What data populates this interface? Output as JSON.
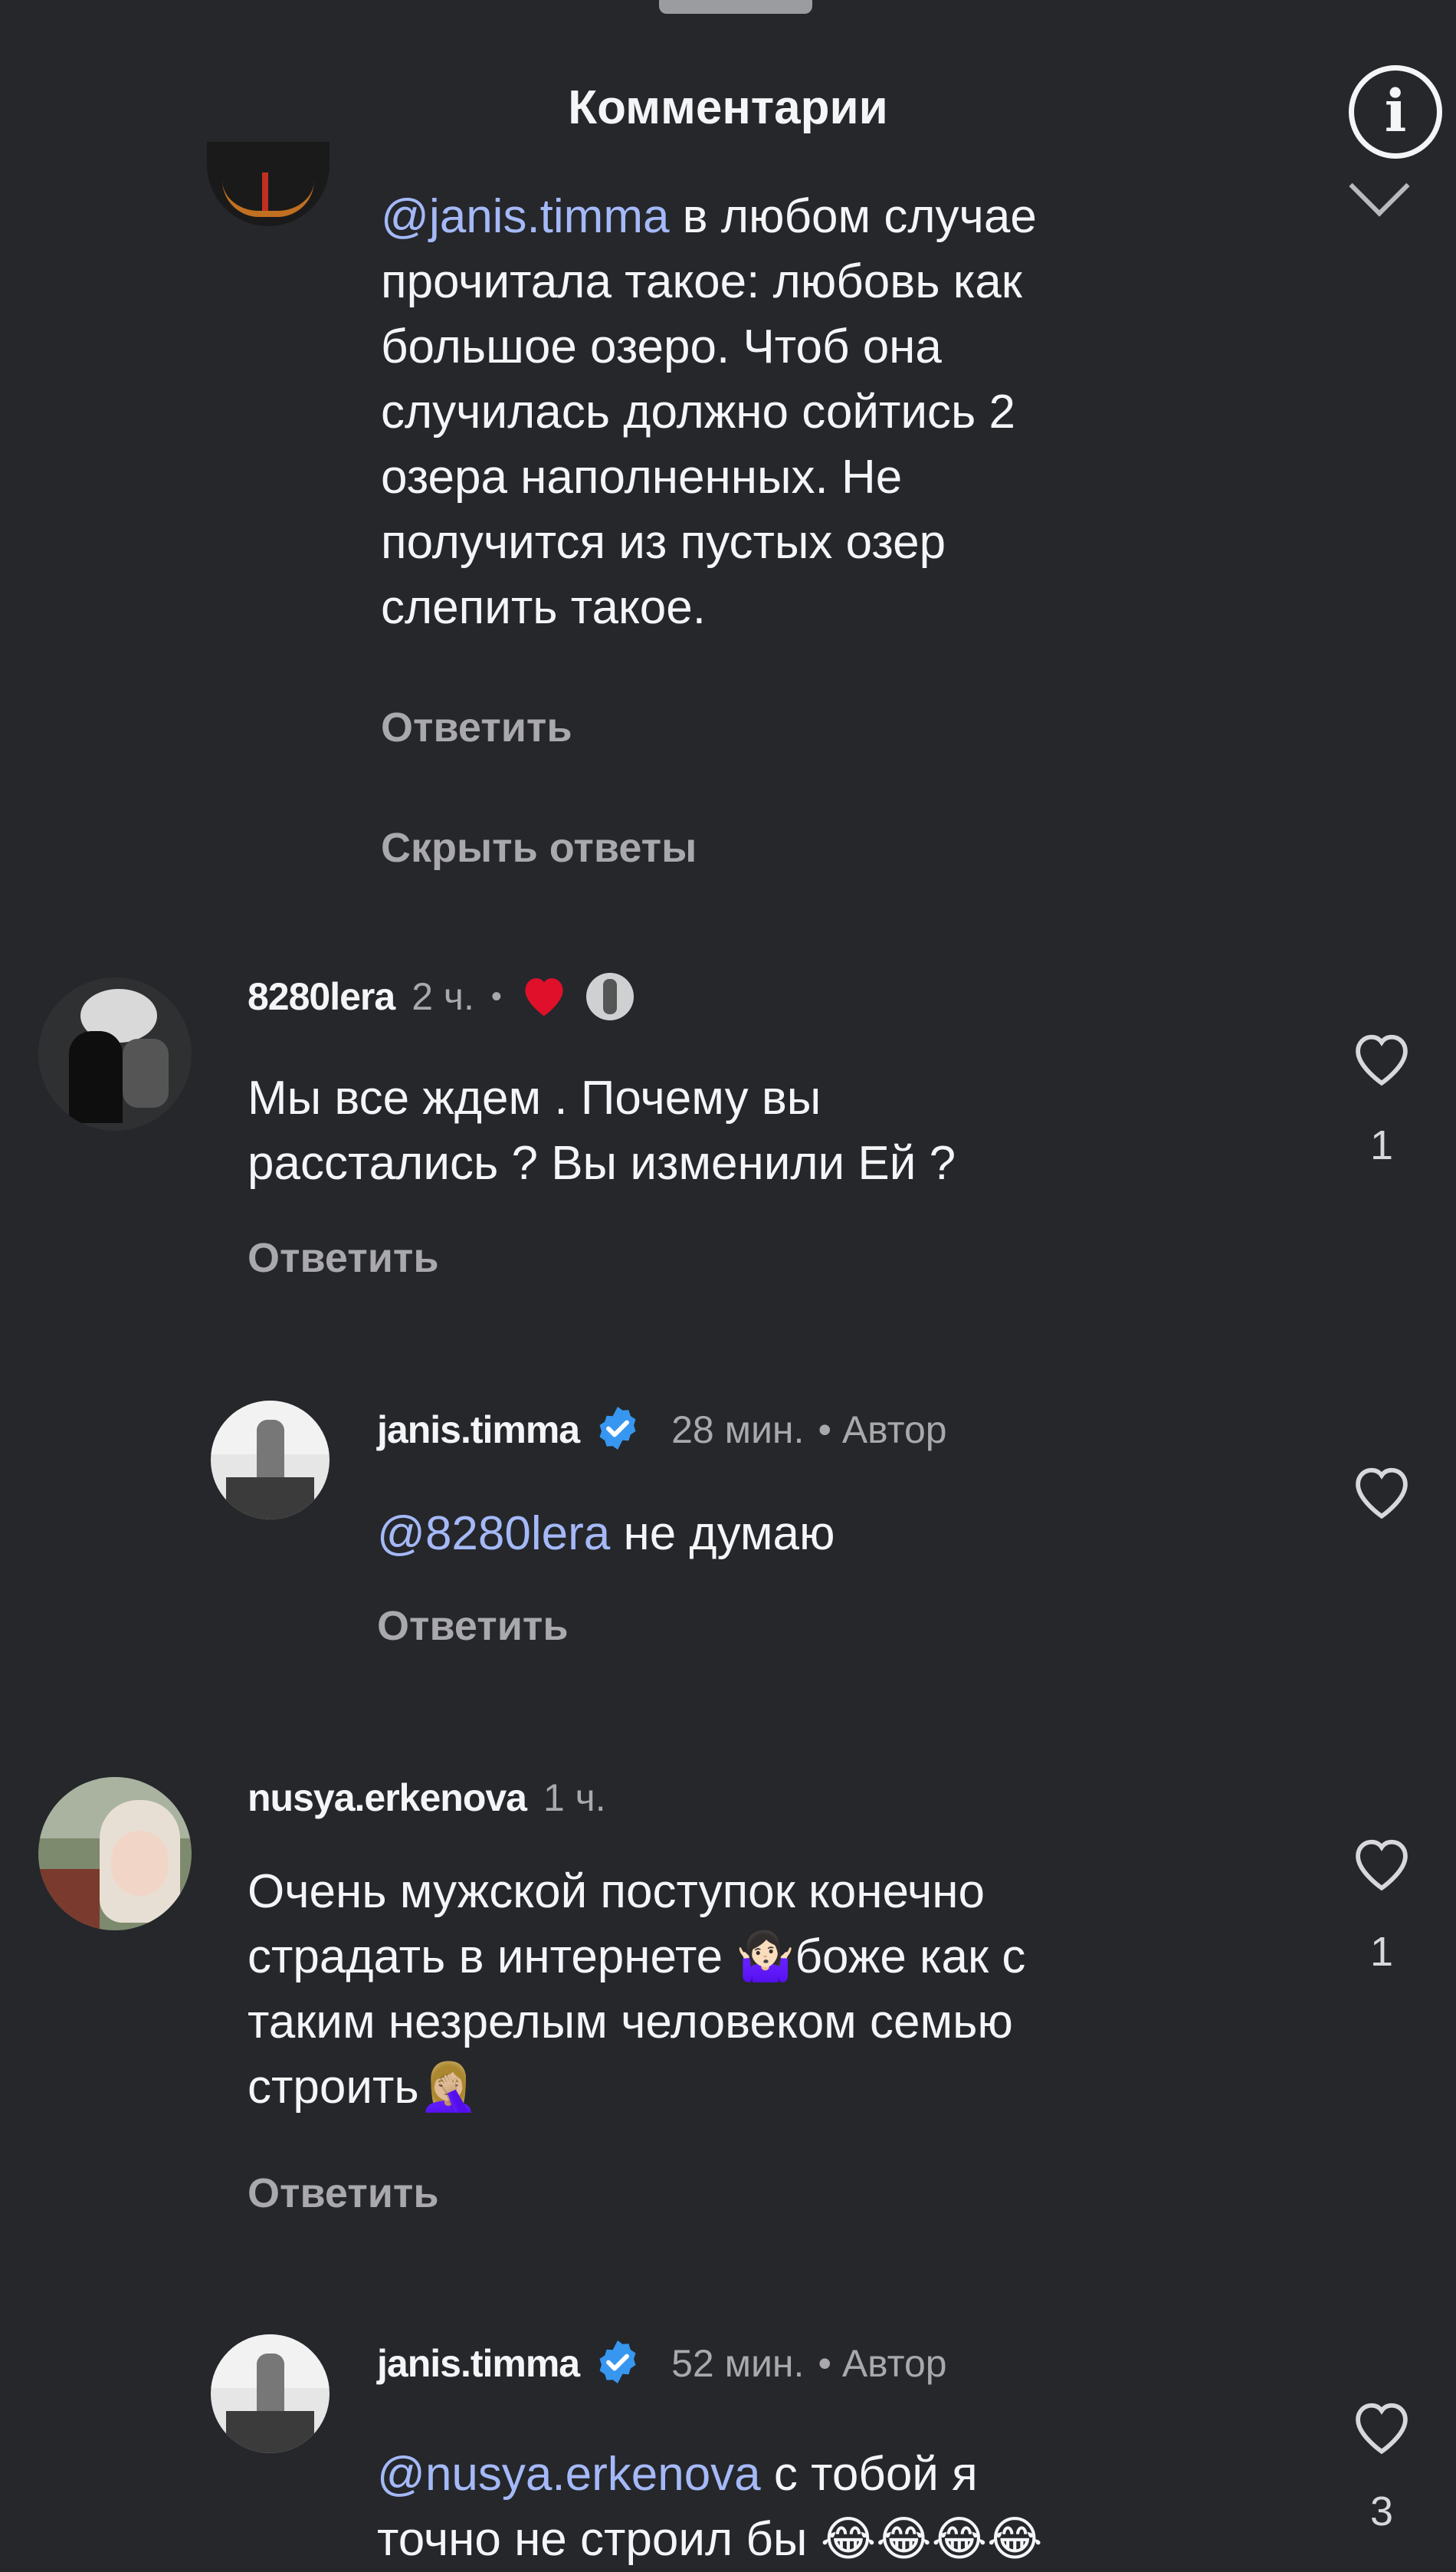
{
  "header": {
    "title": "Комментарии",
    "info_icon": "info-icon"
  },
  "partial_comment": {
    "lines": [
      {
        "mention": "@janis.timma",
        "text": " в любом случае"
      },
      {
        "mention": "",
        "text": "прочитала такое: любовь как"
      },
      {
        "mention": "",
        "text": "большое озеро. Чтоб она"
      },
      {
        "mention": "",
        "text": "случилась должно сойтись 2"
      },
      {
        "mention": "",
        "text": "озера наполненных. Не"
      },
      {
        "mention": "",
        "text": "получится из пустых озер"
      },
      {
        "mention": "",
        "text": "слепить такое."
      }
    ],
    "reply_label": "Ответить",
    "hide_replies_label": "Скрыть ответы"
  },
  "comments": [
    {
      "username": "8280lera",
      "time": "2 ч.",
      "separator": "•",
      "lines": [
        "Мы все ждем . Почему вы",
        "расстались ? Вы изменили Ей ?"
      ],
      "reply_label": "Ответить",
      "likes": "1"
    },
    {
      "username": "janis.timma",
      "time": "28 мин.",
      "author_label": "• Автор",
      "mention": "@8280lera",
      "text": " не думаю",
      "reply_label": "Ответить",
      "likes": ""
    },
    {
      "username": "nusya.erkenova",
      "time": "1 ч.",
      "lines": [
        "Очень мужской поступок конечно",
        "страдать в интернете 🤷🏻‍♀️боже как с",
        "таким незрелым человеком семью",
        "строить🤦🏼‍♀️"
      ],
      "reply_label": "Ответить",
      "likes": "1"
    },
    {
      "username": "janis.timma",
      "time": "52 мин.",
      "author_label": "• Автор",
      "mention": "@nusya.erkenova",
      "text": " с тобой я",
      "line2": "точно не строил бы 😂😂😂😂",
      "likes": "3"
    }
  ],
  "colors": {
    "background": "#25272b",
    "text": "#f3f5f7",
    "secondary": "#a8a8ad",
    "mention": "#a5b9f8",
    "verified": "#3797f0",
    "heart": "#e0102a"
  }
}
